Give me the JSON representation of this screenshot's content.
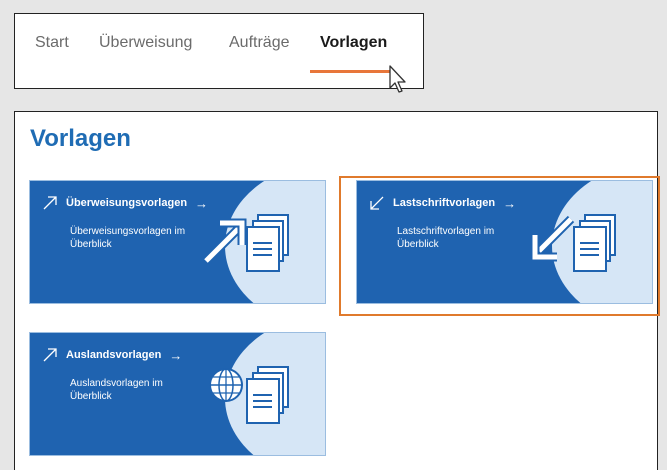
{
  "nav": {
    "items": [
      {
        "label": "Start"
      },
      {
        "label": "Überweisung"
      },
      {
        "label": "Aufträge"
      },
      {
        "label": "Vorlagen"
      }
    ],
    "active_color": "#e8763a"
  },
  "page": {
    "title": "Vorlagen"
  },
  "tiles": [
    {
      "title": "Überweisungsvorlagen",
      "arrow": "→",
      "description": "Überweisungsvorlagen im Überblick",
      "icon": "outgoing-arrow-icon"
    },
    {
      "title": "Lastschriftvorlagen",
      "arrow": "→",
      "description": "Lastschriftvorlagen im Überblick",
      "icon": "incoming-arrow-icon"
    },
    {
      "title": "Auslandsvorlagen",
      "arrow": "→",
      "description": "Auslandsvorlagen im Überblick",
      "icon": "globe-icon"
    }
  ],
  "colors": {
    "tile_background": "#1f63b0",
    "tile_accent": "#d6e6f6",
    "title_color": "#1f6cb4",
    "highlight": "#e07a2c"
  }
}
